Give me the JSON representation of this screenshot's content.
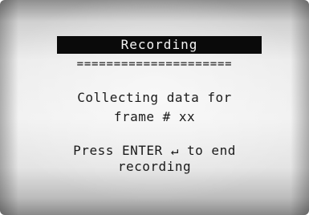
{
  "screen": {
    "title": "Recording",
    "divider": "=====================",
    "message_line1": "Collecting data for",
    "message_line2": "frame # xx",
    "instruction_line1": "Press ENTER ↵ to end",
    "instruction_line2": "recording"
  }
}
